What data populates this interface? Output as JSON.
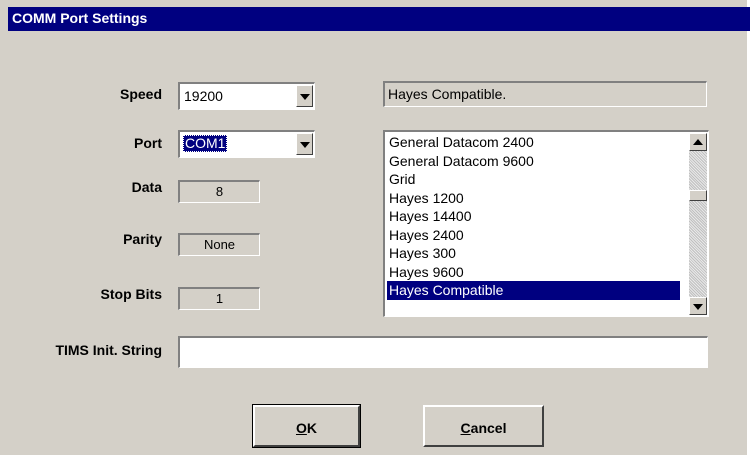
{
  "window": {
    "title": "COMM Port Settings"
  },
  "labels": {
    "speed": "Speed",
    "port": "Port",
    "data": "Data",
    "parity": "Parity",
    "stop_bits": "Stop Bits",
    "tims_init": "TIMS Init. String"
  },
  "fields": {
    "speed": "19200",
    "port": "COM1",
    "data": "8",
    "parity": "None",
    "stop_bits": "1",
    "modem_selected": "Hayes Compatible.",
    "tims_init_value": ""
  },
  "modem_list": {
    "items": [
      "General Datacom 2400",
      "General Datacom 9600",
      "Grid",
      "Hayes 1200",
      "Hayes 14400",
      "Hayes 2400",
      "Hayes 300",
      "Hayes 9600",
      "Hayes Compatible"
    ],
    "selected": "Hayes Compatible"
  },
  "buttons": {
    "ok_mnemonic": "O",
    "ok_rest": "K",
    "cancel_mnemonic": "C",
    "cancel_rest": "ancel"
  },
  "colors": {
    "titlebar": "#000080",
    "dialog": "#d4d0c8",
    "selection": "#000080"
  }
}
